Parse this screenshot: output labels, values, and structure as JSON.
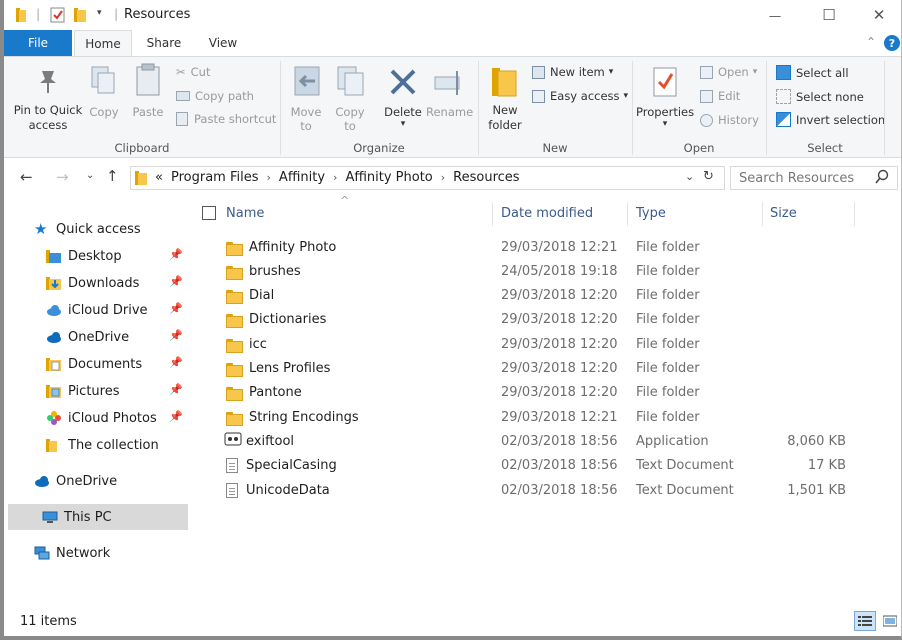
{
  "window": {
    "title": "Resources",
    "controls": {
      "minimize": "—",
      "maximize": "☐",
      "close": "✕"
    }
  },
  "ribbon_tabs": [
    "File",
    "Home",
    "Share",
    "View"
  ],
  "ribbon": {
    "clipboard": {
      "pin": "Pin to Quick access",
      "copy": "Copy",
      "paste": "Paste",
      "cut": "Cut",
      "copy_path": "Copy path",
      "paste_shortcut": "Paste shortcut",
      "label": "Clipboard"
    },
    "organize": {
      "move_to": "Move to",
      "copy_to": "Copy to",
      "delete": "Delete",
      "rename": "Rename",
      "label": "Organize"
    },
    "new": {
      "new_folder": "New folder",
      "new_item": "New item",
      "easy_access": "Easy access",
      "label": "New"
    },
    "open": {
      "properties": "Properties",
      "open": "Open",
      "edit": "Edit",
      "history": "History",
      "label": "Open"
    },
    "select": {
      "select_all": "Select all",
      "select_none": "Select none",
      "invert": "Invert selection",
      "label": "Select"
    }
  },
  "address": {
    "overflow": "«",
    "crumbs": [
      "Program Files",
      "Affinity",
      "Affinity Photo",
      "Resources"
    ],
    "search_placeholder": "Search Resources"
  },
  "nav": {
    "quick_access": "Quick access",
    "items": [
      {
        "label": "Desktop",
        "pinned": true
      },
      {
        "label": "Downloads",
        "pinned": true
      },
      {
        "label": "iCloud Drive",
        "pinned": true
      },
      {
        "label": "OneDrive",
        "pinned": true
      },
      {
        "label": "Documents",
        "pinned": true
      },
      {
        "label": "Pictures",
        "pinned": true
      },
      {
        "label": "iCloud Photos",
        "pinned": true
      },
      {
        "label": "The collection",
        "pinned": false
      }
    ],
    "onedrive": "OneDrive",
    "this_pc": "This PC",
    "network": "Network"
  },
  "columns": {
    "name": "Name",
    "date": "Date modified",
    "type": "Type",
    "size": "Size"
  },
  "files": [
    {
      "name": "Affinity Photo",
      "date": "29/03/2018 12:21",
      "type": "File folder",
      "size": "",
      "icon": "folder"
    },
    {
      "name": "brushes",
      "date": "24/05/2018 19:18",
      "type": "File folder",
      "size": "",
      "icon": "folder"
    },
    {
      "name": "Dial",
      "date": "29/03/2018 12:20",
      "type": "File folder",
      "size": "",
      "icon": "folder"
    },
    {
      "name": "Dictionaries",
      "date": "29/03/2018 12:20",
      "type": "File folder",
      "size": "",
      "icon": "folder"
    },
    {
      "name": "icc",
      "date": "29/03/2018 12:20",
      "type": "File folder",
      "size": "",
      "icon": "folder"
    },
    {
      "name": "Lens Profiles",
      "date": "29/03/2018 12:20",
      "type": "File folder",
      "size": "",
      "icon": "folder"
    },
    {
      "name": "Pantone",
      "date": "29/03/2018 12:20",
      "type": "File folder",
      "size": "",
      "icon": "folder"
    },
    {
      "name": "String Encodings",
      "date": "29/03/2018 12:21",
      "type": "File folder",
      "size": "",
      "icon": "folder"
    },
    {
      "name": "exiftool",
      "date": "02/03/2018 18:56",
      "type": "Application",
      "size": "8,060 KB",
      "icon": "app"
    },
    {
      "name": "SpecialCasing",
      "date": "02/03/2018 18:56",
      "type": "Text Document",
      "size": "17 KB",
      "icon": "doc"
    },
    {
      "name": "UnicodeData",
      "date": "02/03/2018 18:56",
      "type": "Text Document",
      "size": "1,501 KB",
      "icon": "doc"
    }
  ],
  "status": {
    "count": "11 items"
  },
  "colors": {
    "accent": "#1979ca",
    "folder": "#f7c64a",
    "header_text": "#3c5a8a",
    "selected_nav": "#d9d9d9"
  }
}
